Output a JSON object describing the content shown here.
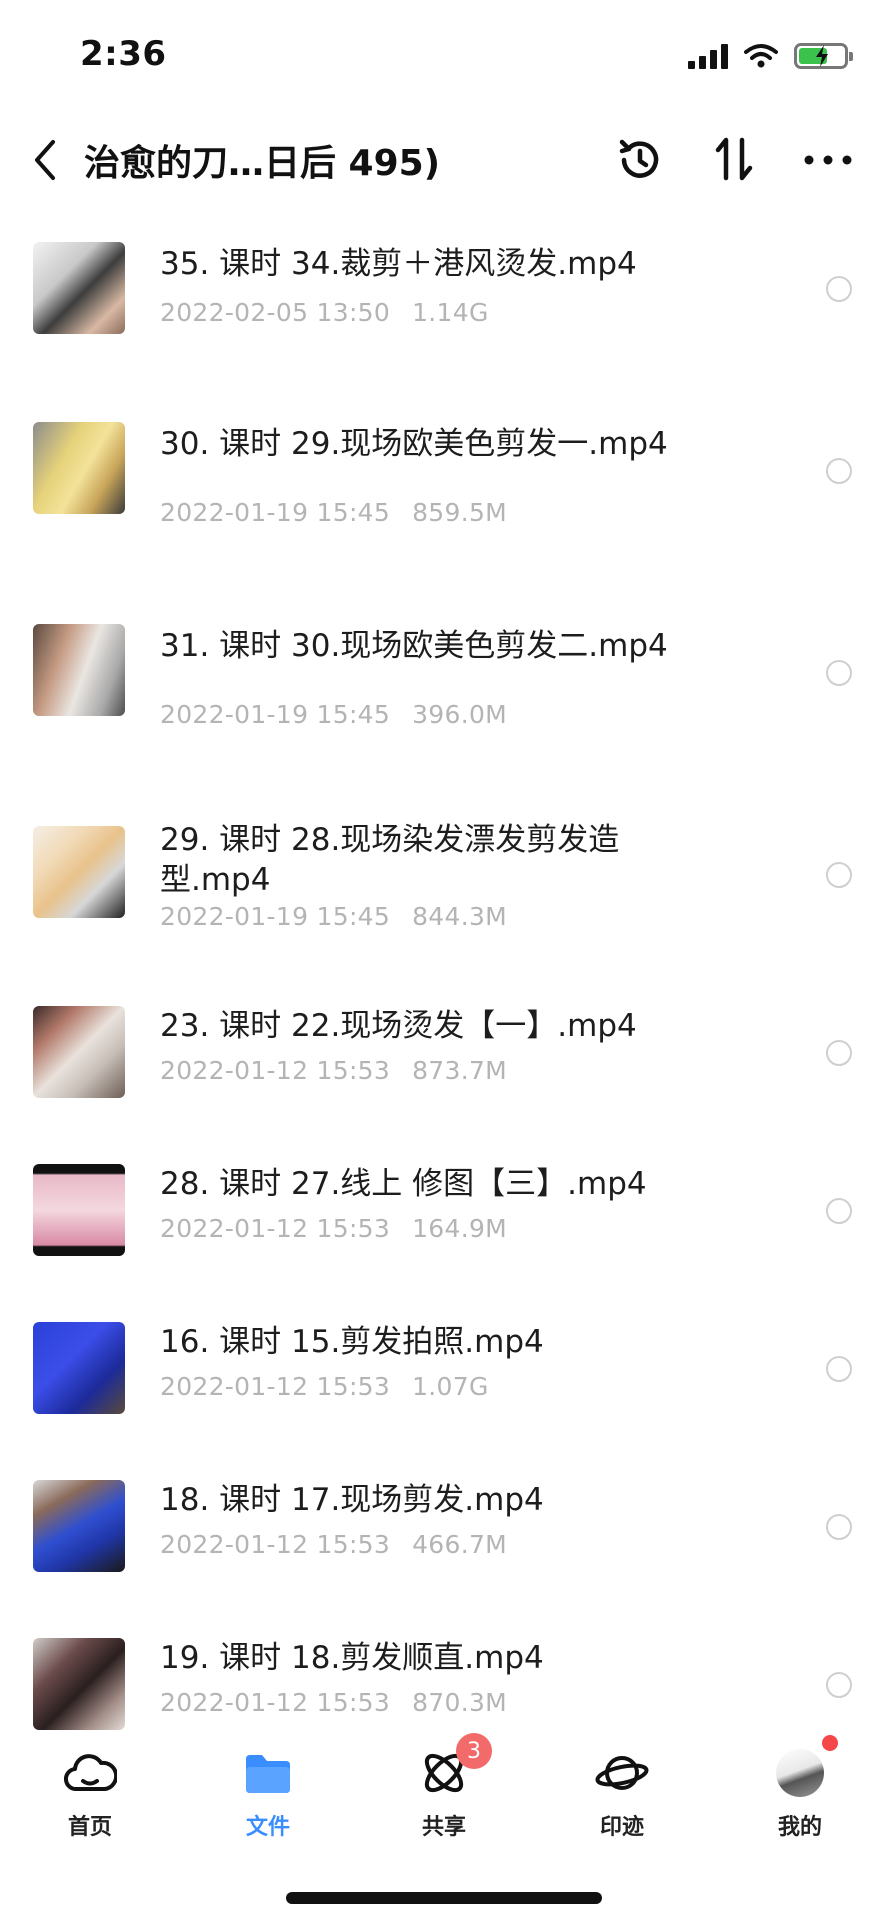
{
  "status_bar": {
    "time": "2:36",
    "icons": [
      "signal-icon",
      "wifi-icon",
      "battery-charging-icon"
    ]
  },
  "header": {
    "title": "治愈的刀…日后 495)",
    "actions": [
      "history-icon",
      "sort-icon",
      "more-icon"
    ]
  },
  "colors": {
    "accent": "#3a8dff",
    "meta_text": "#b4b4b4",
    "badge": "#f26a6a",
    "battery_green": "#3ac24c"
  },
  "files": [
    {
      "name": "35. 课时 34.裁剪＋港风烫发.mp4",
      "date": "2022-02-05 13:50",
      "size": "1.14G"
    },
    {
      "name": "30. 课时 29.现场欧美色剪发一.mp4",
      "date": "2022-01-19 15:45",
      "size": "859.5M"
    },
    {
      "name": "31. 课时 30.现场欧美色剪发二.mp4",
      "date": "2022-01-19 15:45",
      "size": "396.0M"
    },
    {
      "name": "29. 课时 28.现场染发漂发剪发造型.mp4",
      "date": "2022-01-19 15:45",
      "size": "844.3M"
    },
    {
      "name": "23. 课时 22.现场烫发【一】.mp4",
      "date": "2022-01-12 15:53",
      "size": "873.7M"
    },
    {
      "name": "28. 课时 27.线上 修图【三】.mp4",
      "date": "2022-01-12 15:53",
      "size": "164.9M"
    },
    {
      "name": "16. 课时 15.剪发拍照.mp4",
      "date": "2022-01-12 15:53",
      "size": "1.07G"
    },
    {
      "name": "18. 课时 17.现场剪发.mp4",
      "date": "2022-01-12 15:53",
      "size": "466.7M"
    },
    {
      "name": "19. 课时 18.剪发顺直.mp4",
      "date": "2022-01-12 15:53",
      "size": "870.3M"
    }
  ],
  "tabs": [
    {
      "label": "首页",
      "icon": "cloud-icon",
      "active": false
    },
    {
      "label": "文件",
      "icon": "folder-icon",
      "active": true
    },
    {
      "label": "共享",
      "icon": "share-orbit-icon",
      "active": false,
      "badge": "3"
    },
    {
      "label": "印迹",
      "icon": "planet-icon",
      "active": false
    },
    {
      "label": "我的",
      "icon": "avatar-icon",
      "active": false
    }
  ]
}
